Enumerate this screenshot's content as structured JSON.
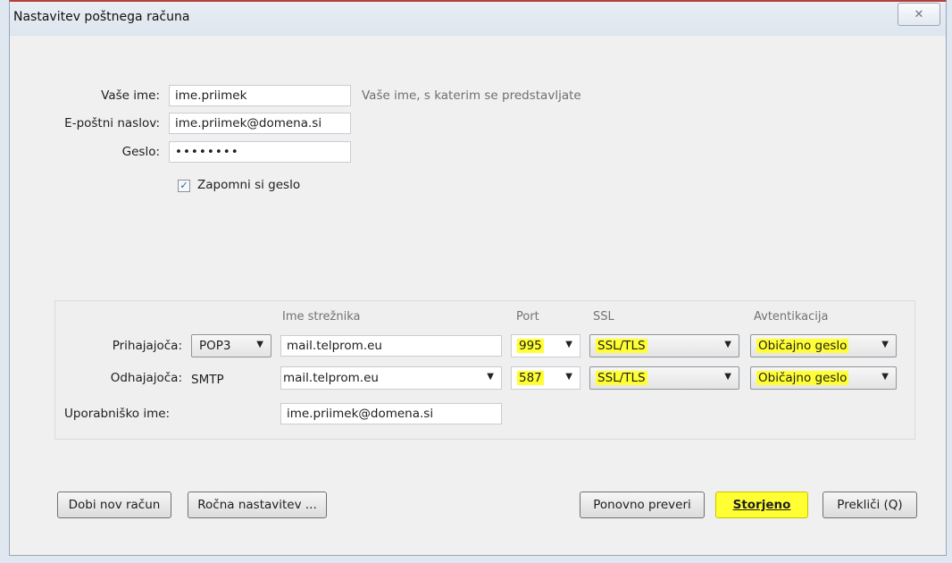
{
  "window": {
    "title": "Nastavitev poštnega računa",
    "close_glyph": "✕"
  },
  "account": {
    "name_label": "Vaše ime:",
    "name_value": "ime.priimek",
    "name_hint": "Vaše ime, s katerim se predstavljate",
    "email_label": "E-poštni naslov:",
    "email_value": "ime.priimek@domena.si",
    "password_label": "Geslo:",
    "password_value": "••••••••",
    "remember_label": "Zapomni si geslo",
    "remember_checked": true
  },
  "server": {
    "headers": {
      "hostname": "Ime strežnika",
      "port": "Port",
      "ssl": "SSL",
      "auth": "Avtentikacija"
    },
    "incoming": {
      "label": "Prihajajoča:",
      "protocol": "POP3",
      "hostname": "mail.telprom.eu",
      "port": "995",
      "ssl": "SSL/TLS",
      "auth": "Običajno geslo"
    },
    "outgoing": {
      "label": "Odhajajoča:",
      "protocol": "SMTP",
      "hostname": "mail.telprom.eu",
      "port": "587",
      "ssl": "SSL/TLS",
      "auth": "Običajno geslo"
    },
    "username_label": "Uporabniško ime:",
    "username_value": "ime.priimek@domena.si"
  },
  "buttons": {
    "new_account": "Dobi nov račun",
    "manual_config": "Ročna nastavitev ...",
    "retest": "Ponovno preveri",
    "done": "Storjeno",
    "cancel": "Prekliči (Q)"
  },
  "colors": {
    "highlight": "#ffff33",
    "title_accent": "#b3403a"
  },
  "icons": {
    "close": "close-icon",
    "dropdown": "chevron-down-icon",
    "checkbox": "checkmark-icon"
  }
}
